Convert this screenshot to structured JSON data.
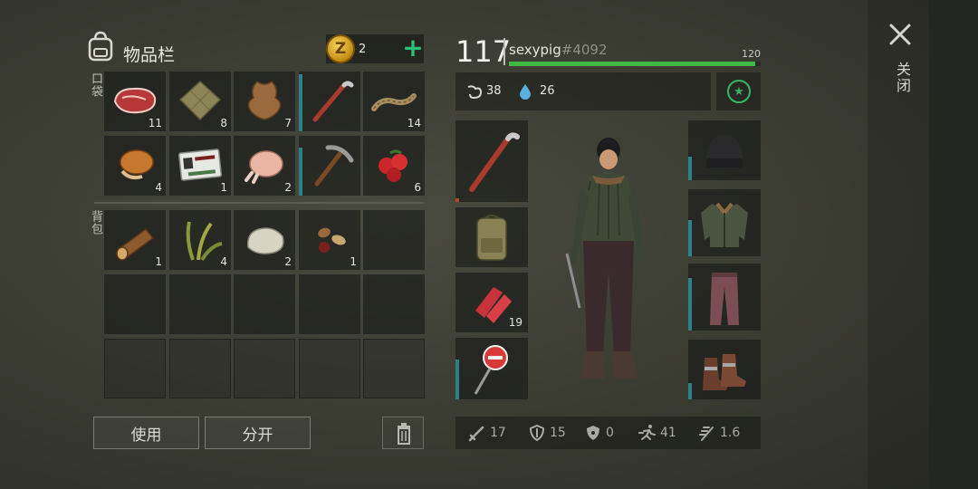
{
  "inventory": {
    "title": "物品栏",
    "coins": "2",
    "add_symbol": "+",
    "pockets_label": "口袋",
    "backpack_label": "背包",
    "pockets": [
      {
        "icon": "steak-icon",
        "count": "11"
      },
      {
        "icon": "cloth-icon",
        "count": "8"
      },
      {
        "icon": "animal-hide-icon",
        "count": "7"
      },
      {
        "icon": "crowbar-icon",
        "count": "",
        "durability": 0.95
      },
      {
        "icon": "rope-icon",
        "count": "14"
      },
      {
        "icon": "cooked-chicken-icon",
        "count": "4"
      },
      {
        "icon": "military-id-card-icon",
        "count": "1"
      },
      {
        "icon": "raw-chicken-icon",
        "count": "2"
      },
      {
        "icon": "pickaxe-icon",
        "count": "",
        "durability": 0.8
      },
      {
        "icon": "berries-icon",
        "count": "6"
      }
    ],
    "backpack": [
      {
        "icon": "wood-log-icon",
        "count": "1"
      },
      {
        "icon": "plant-fiber-icon",
        "count": "4"
      },
      {
        "icon": "stone-icon",
        "count": "2"
      },
      {
        "icon": "seeds-icon",
        "count": "1"
      }
    ],
    "use_button": "使用",
    "split_button": "分开"
  },
  "player": {
    "level": "117",
    "name": "sexypig",
    "tag": "#4092",
    "hp_max": "120",
    "hp_fraction": 0.98,
    "hunger": "38",
    "thirst": "26"
  },
  "equipment": {
    "left": [
      {
        "icon": "crowbar-icon",
        "count": ""
      },
      {
        "icon": "backpack-icon",
        "count": ""
      },
      {
        "icon": "bandage-icon",
        "count": "19"
      },
      {
        "icon": "stop-sign-weapon-icon",
        "count": ""
      }
    ],
    "right": [
      {
        "icon": "beanie-icon"
      },
      {
        "icon": "jacket-icon"
      },
      {
        "icon": "pants-icon"
      },
      {
        "icon": "boots-icon"
      }
    ]
  },
  "combat_stats": {
    "damage": "17",
    "armor": "15",
    "radiation": "0",
    "speed": "41",
    "attack_speed": "1.6"
  },
  "close_label": "关闭",
  "colors": {
    "accent_green": "#2bc079",
    "hp_green": "#3fb845",
    "durability_teal": "#2f7f86"
  }
}
